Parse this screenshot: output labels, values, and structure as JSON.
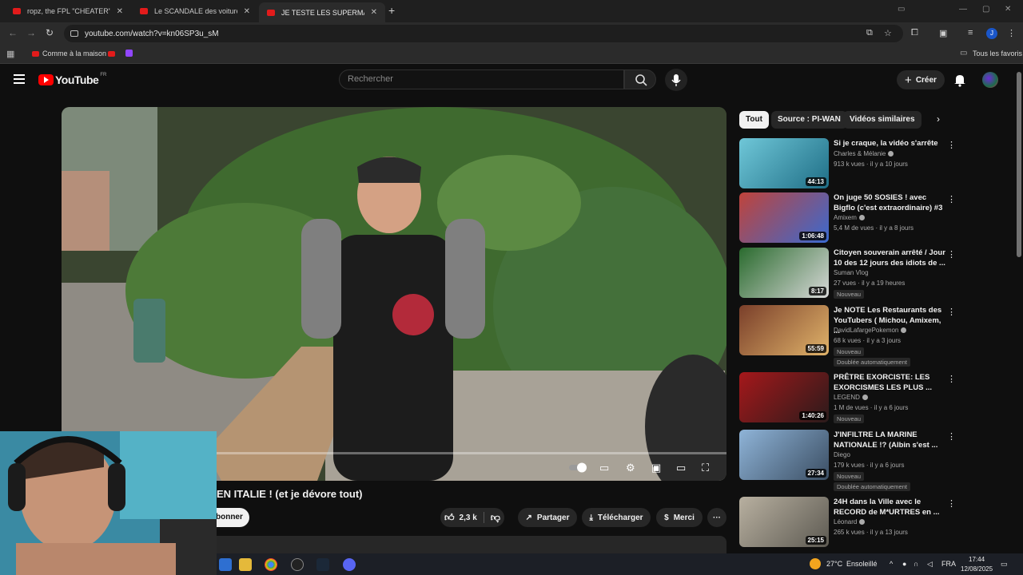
{
  "browser": {
    "tabs": [
      {
        "title": "ropz, the FPL \"CHEATER\" - Mo",
        "active": false
      },
      {
        "title": "Le SCANDALE des voitures ÉLE",
        "active": false
      },
      {
        "title": "JE TESTE LES SUPERMARCHÉS I",
        "active": true
      }
    ],
    "new_tab": "+",
    "url": "youtube.com/watch?v=kn06SP3u_sM",
    "profile_initial": "J",
    "bookmarks": {
      "item1": "Comme à la maison",
      "all": "Tous les favoris"
    }
  },
  "youtube": {
    "logo_text": "YouTube",
    "country_code": "FR",
    "search_placeholder": "Rechercher",
    "create_label": "Créer"
  },
  "video": {
    "title_visible": "EN ITALIE ! (et je dévore tout)",
    "subscribe_partial": "bonner",
    "likes": "2,3 k",
    "share": "Partager",
    "download": "Télécharger",
    "thanks": "Merci",
    "more": "···"
  },
  "chips": [
    "Tout",
    "Source : PI-WAN",
    "Vidéos similaires"
  ],
  "recommendations": [
    {
      "title": "Si je craque, la vidéo s'arrête",
      "channel": "Charles & Mélanie",
      "verified": true,
      "meta": "913 k vues · il y a 10 jours",
      "duration": "44:13",
      "badges": [],
      "thumb_colors": [
        "#6fc7d8",
        "#1f6e86"
      ]
    },
    {
      "title": "On juge 50 SOSIES ! avec Bigflo (c'est extraordinaire) #3",
      "channel": "Amixem",
      "verified": true,
      "meta": "5,4 M de vues · il y a 8 jours",
      "duration": "1:06:48",
      "badges": [],
      "thumb_colors": [
        "#c0433a",
        "#3a6ad0"
      ]
    },
    {
      "title": "Citoyen souverain arrêté / Jour 10 des 12 jours des idiots de ...",
      "channel": "Suman Vlog",
      "verified": false,
      "meta": "27 vues · il y a 19 heures",
      "duration": "8:17",
      "badges": [
        "Nouveau"
      ],
      "thumb_colors": [
        "#2a6b2e",
        "#d8d8d8"
      ]
    },
    {
      "title": "Je NOTE Les Restaurants des YouTubers ( Michou, Amixem, ...",
      "channel": "DavidLafargePokemon",
      "verified": true,
      "meta": "68 k vues · il y a 3 jours",
      "duration": "55:59",
      "badges": [
        "Nouveau",
        "Doublée automatiquement"
      ],
      "thumb_colors": [
        "#7a3f2a",
        "#e0b36a"
      ]
    },
    {
      "title": "PRÊTRE EXORCISTE: LES EXORCISMES LES PLUS ...",
      "channel": "LEGEND",
      "verified": true,
      "meta": "1 M de vues · il y a 6 jours",
      "duration": "1:40:26",
      "badges": [
        "Nouveau"
      ],
      "thumb_colors": [
        "#a5181b",
        "#2b1b1b"
      ]
    },
    {
      "title": "J'INFILTRE LA MARINE NATIONALE !? (Albin s'est ...",
      "channel": "Diego",
      "verified": false,
      "meta": "179 k vues · il y a 6 jours",
      "duration": "27:34",
      "badges": [
        "Nouveau",
        "Doublée automatiquement"
      ],
      "thumb_colors": [
        "#8fb4d8",
        "#3b4e63"
      ]
    },
    {
      "title": "24H dans la Ville avec le RECORD de M*URTRES en ...",
      "channel": "Léonard",
      "verified": true,
      "meta": "265 k vues · il y a 13 jours",
      "duration": "25:15",
      "badges": [],
      "thumb_colors": [
        "#b8b0a0",
        "#5d5a52"
      ]
    }
  ],
  "taskbar": {
    "temperature": "27°C",
    "weather": "Ensoleillé",
    "lang": "FRA",
    "time": "17:44",
    "date": "12/08/2025"
  }
}
